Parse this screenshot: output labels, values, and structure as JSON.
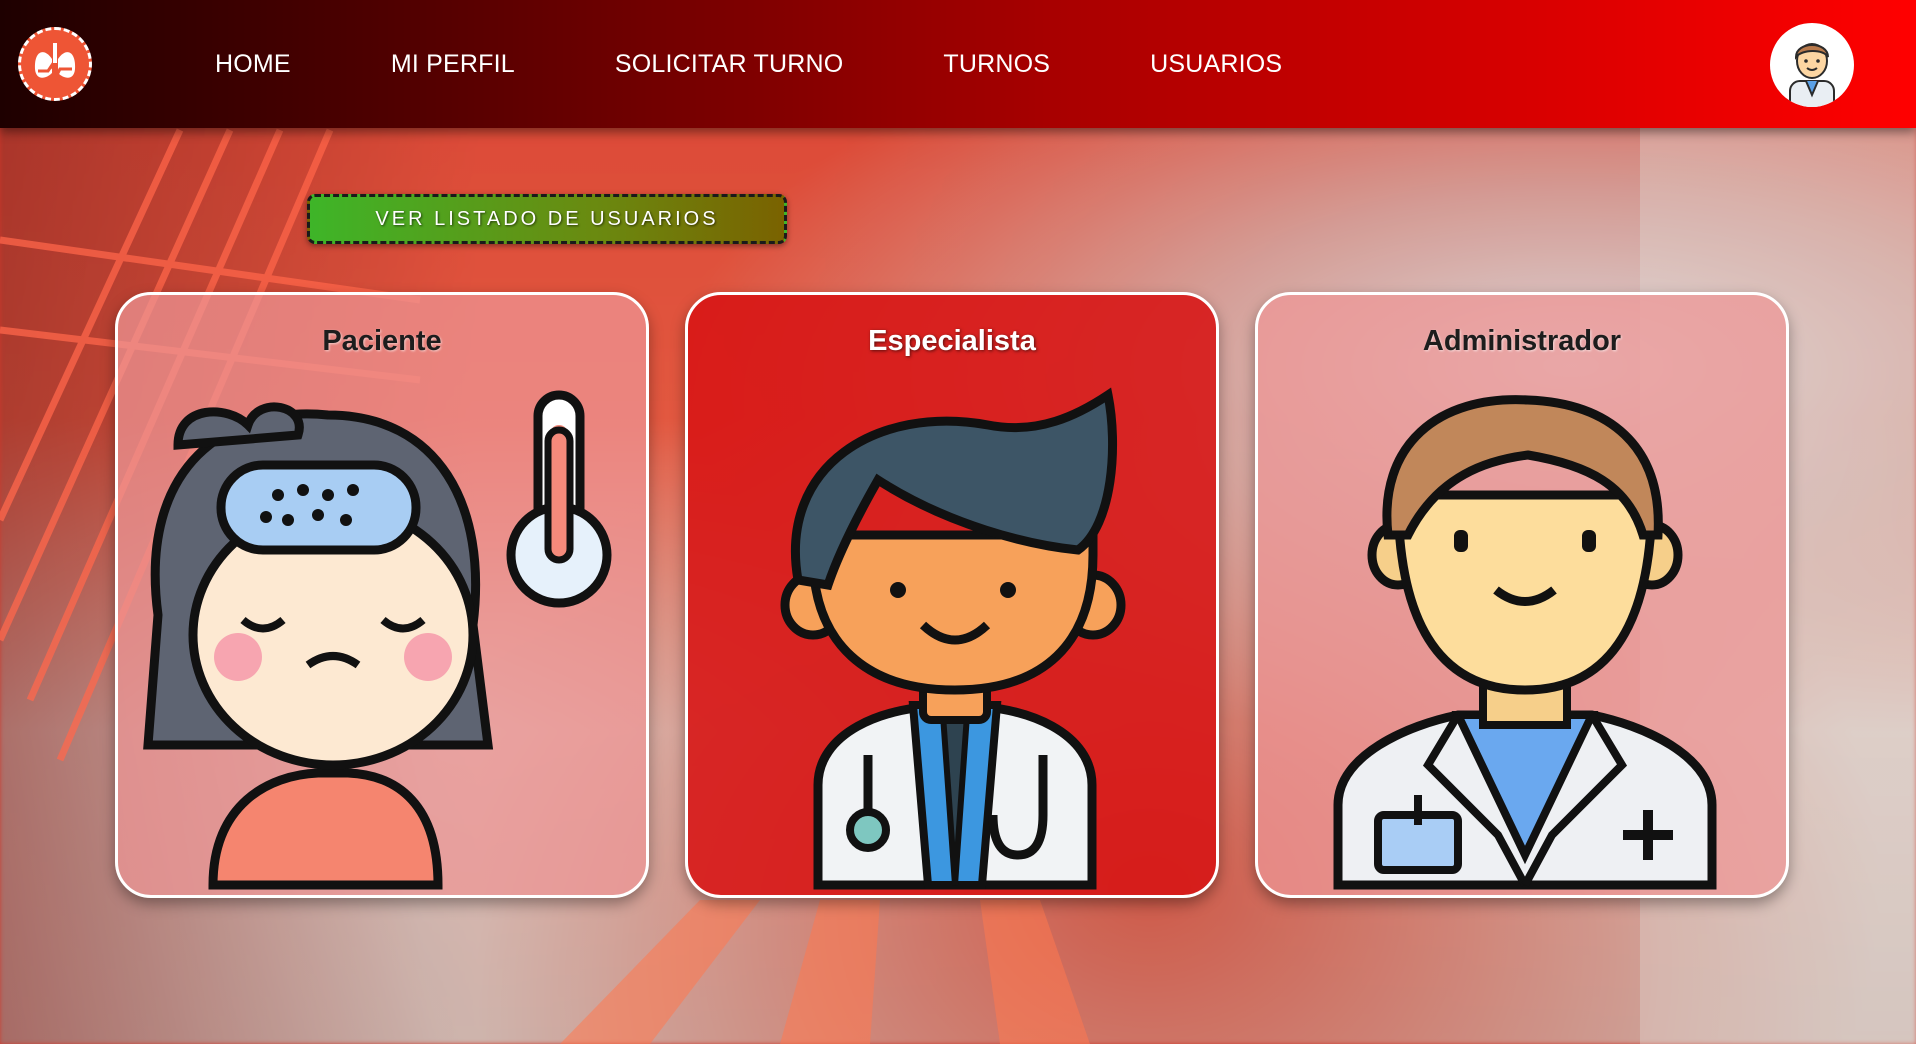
{
  "navbar": {
    "logo_icon": "lungs-heart-logo-icon",
    "links": [
      {
        "label": "HOME"
      },
      {
        "label": "MI PERFIL"
      },
      {
        "label": "SOLICITAR TURNO"
      },
      {
        "label": "TURNOS"
      },
      {
        "label": "USUARIOS"
      }
    ],
    "avatar_icon": "doctor-avatar-icon"
  },
  "actions": {
    "list_users_label": "VER LISTADO DE USUARIOS"
  },
  "cards": [
    {
      "title": "Paciente",
      "icon": "sick-patient-icon"
    },
    {
      "title": "Especialista",
      "icon": "doctor-stethoscope-icon"
    },
    {
      "title": "Administrador",
      "icon": "admin-doctor-icon"
    }
  ],
  "colors": {
    "navbar_start": "#1e0000",
    "navbar_end": "#ff0000",
    "button_green": "#3eb528",
    "card_highlight": "#d71414"
  }
}
